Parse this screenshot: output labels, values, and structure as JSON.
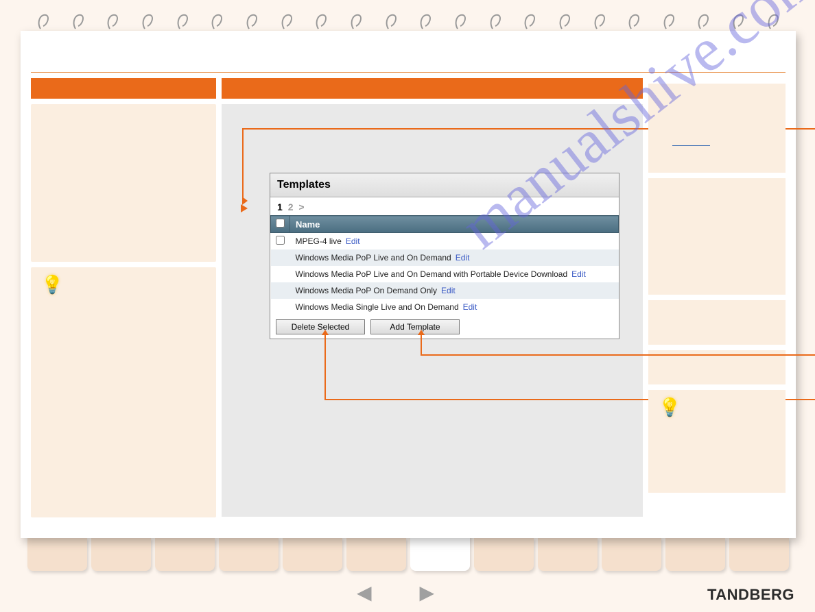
{
  "panel": {
    "title": "Templates",
    "pager": {
      "active": "1",
      "other": "2",
      "next": ">"
    },
    "header": {
      "name_col": "Name"
    },
    "rows": [
      {
        "name": "MPEG-4 live",
        "edit": "Edit",
        "alt": false,
        "show_cb": true
      },
      {
        "name": "Windows Media PoP Live and On Demand",
        "edit": "Edit",
        "alt": true,
        "show_cb": false
      },
      {
        "name": "Windows Media PoP Live and On Demand with Portable Device Download",
        "edit": "Edit",
        "alt": false,
        "show_cb": false
      },
      {
        "name": "Windows Media PoP On Demand Only",
        "edit": "Edit",
        "alt": true,
        "show_cb": false
      },
      {
        "name": "Windows Media Single Live and On Demand",
        "edit": "Edit",
        "alt": false,
        "show_cb": false
      }
    ],
    "buttons": {
      "delete": "Delete Selected",
      "add": "Add Template"
    }
  },
  "brand": "TANDBERG",
  "watermark": "manualshive.com",
  "icons": {
    "bulb": "💡"
  }
}
